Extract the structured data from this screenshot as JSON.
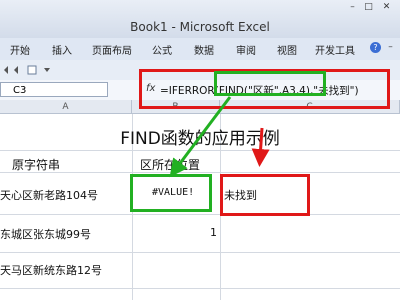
{
  "window": {
    "title": "Book1 - Microsoft Excel"
  },
  "ribbon": {
    "tabs": [
      "开始",
      "插入",
      "页面布局",
      "公式",
      "数据",
      "审阅",
      "视图",
      "开发工具"
    ],
    "help_icon": "help-icon"
  },
  "formula_bar": {
    "name_box": "C3",
    "fx": "fx",
    "formula": "=IFERROR(FIND(\"区新\",A3,4),\"未找到\")"
  },
  "columns": [
    "A",
    "B",
    "C"
  ],
  "sheet": {
    "title": "FIND函数的应用示例",
    "headers": {
      "a": "原字符串",
      "b": "区所在位置"
    },
    "rows": [
      {
        "a": "天心区新老路104号",
        "b": "#VALUE!",
        "c": "未找到"
      },
      {
        "a": "东城区张东城99号",
        "b": "1",
        "c": ""
      },
      {
        "a": "天马区新统东路12号",
        "b": "",
        "c": ""
      }
    ]
  },
  "annotation_colors": {
    "red": "#e01818",
    "green": "#22b022"
  }
}
